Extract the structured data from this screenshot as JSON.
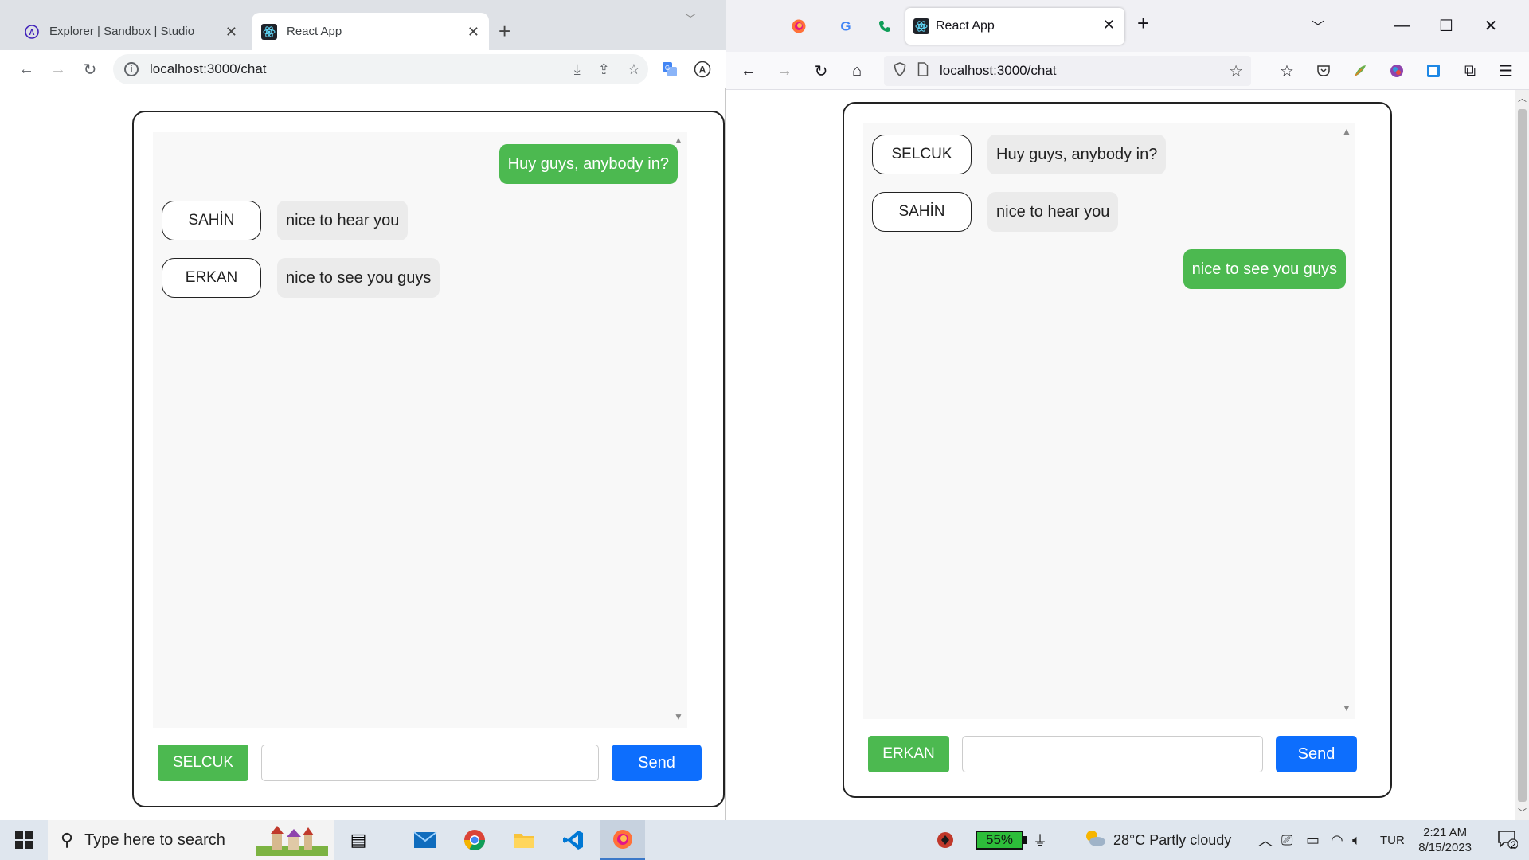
{
  "colors": {
    "green": "#4cb950",
    "blue": "#0d6efd",
    "bubble_grey": "#ebebeb"
  },
  "left_window": {
    "tabs": [
      {
        "title": "Explorer | Sandbox | Studio",
        "icon": "apollo-icon"
      },
      {
        "title": "React App",
        "icon": "react-icon"
      }
    ],
    "url": "localhost:3000/chat",
    "chat": {
      "messages": [
        {
          "side": "right",
          "text": "Huy guys, anybody in?"
        },
        {
          "side": "left",
          "sender": "SAHİN",
          "text": "nice to hear you"
        },
        {
          "side": "left",
          "sender": "ERKAN",
          "text": "nice to see you guys"
        }
      ],
      "current_user": "SELCUK",
      "input_value": "",
      "send_label": "Send"
    }
  },
  "right_window": {
    "pinned_tabs": [
      "firefox-icon",
      "google-icon",
      "phone-icon"
    ],
    "tab_title": "React App",
    "url": "localhost:3000/chat",
    "chat": {
      "messages": [
        {
          "side": "left",
          "sender": "SELCUK",
          "text": "Huy guys, anybody in?"
        },
        {
          "side": "left",
          "sender": "SAHİN",
          "text": "nice to hear you"
        },
        {
          "side": "right",
          "text": "nice to see you guys"
        }
      ],
      "current_user": "ERKAN",
      "input_value": "",
      "send_label": "Send"
    }
  },
  "taskbar": {
    "search_placeholder": "Type here to search",
    "battery": "55%",
    "weather": "28°C  Partly cloudy",
    "language": "TUR",
    "time": "2:21 AM",
    "date": "8/15/2023",
    "notifications": "2"
  }
}
